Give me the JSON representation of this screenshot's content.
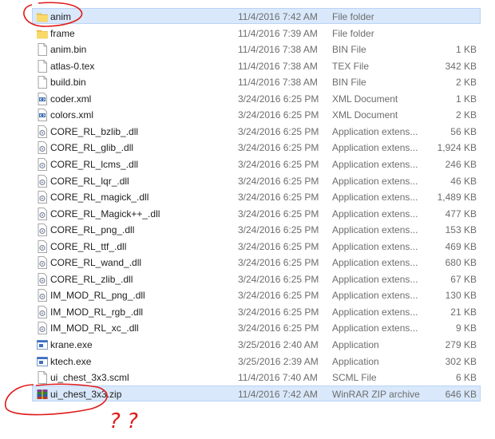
{
  "files": [
    {
      "name": "anim",
      "date": "11/4/2016 7:42 AM",
      "type": "File folder",
      "size": "",
      "icon": "folder-icon",
      "selected": true
    },
    {
      "name": "frame",
      "date": "11/4/2016 7:39 AM",
      "type": "File folder",
      "size": "",
      "icon": "folder-icon",
      "selected": false
    },
    {
      "name": "anim.bin",
      "date": "11/4/2016 7:38 AM",
      "type": "BIN File",
      "size": "1 KB",
      "icon": "file-icon",
      "selected": false
    },
    {
      "name": "atlas-0.tex",
      "date": "11/4/2016 7:38 AM",
      "type": "TEX File",
      "size": "342 KB",
      "icon": "file-icon",
      "selected": false
    },
    {
      "name": "build.bin",
      "date": "11/4/2016 7:38 AM",
      "type": "BIN File",
      "size": "2 KB",
      "icon": "file-icon",
      "selected": false
    },
    {
      "name": "coder.xml",
      "date": "3/24/2016 6:25 PM",
      "type": "XML Document",
      "size": "1 KB",
      "icon": "xml-file-icon",
      "selected": false
    },
    {
      "name": "colors.xml",
      "date": "3/24/2016 6:25 PM",
      "type": "XML Document",
      "size": "2 KB",
      "icon": "xml-file-icon",
      "selected": false
    },
    {
      "name": "CORE_RL_bzlib_.dll",
      "date": "3/24/2016 6:25 PM",
      "type": "Application extens...",
      "size": "56 KB",
      "icon": "dll-file-icon",
      "selected": false
    },
    {
      "name": "CORE_RL_glib_.dll",
      "date": "3/24/2016 6:25 PM",
      "type": "Application extens...",
      "size": "1,924 KB",
      "icon": "dll-file-icon",
      "selected": false
    },
    {
      "name": "CORE_RL_lcms_.dll",
      "date": "3/24/2016 6:25 PM",
      "type": "Application extens...",
      "size": "246 KB",
      "icon": "dll-file-icon",
      "selected": false
    },
    {
      "name": "CORE_RL_lqr_.dll",
      "date": "3/24/2016 6:25 PM",
      "type": "Application extens...",
      "size": "46 KB",
      "icon": "dll-file-icon",
      "selected": false
    },
    {
      "name": "CORE_RL_magick_.dll",
      "date": "3/24/2016 6:25 PM",
      "type": "Application extens...",
      "size": "1,489 KB",
      "icon": "dll-file-icon",
      "selected": false
    },
    {
      "name": "CORE_RL_Magick++_.dll",
      "date": "3/24/2016 6:25 PM",
      "type": "Application extens...",
      "size": "477 KB",
      "icon": "dll-file-icon",
      "selected": false
    },
    {
      "name": "CORE_RL_png_.dll",
      "date": "3/24/2016 6:25 PM",
      "type": "Application extens...",
      "size": "153 KB",
      "icon": "dll-file-icon",
      "selected": false
    },
    {
      "name": "CORE_RL_ttf_.dll",
      "date": "3/24/2016 6:25 PM",
      "type": "Application extens...",
      "size": "469 KB",
      "icon": "dll-file-icon",
      "selected": false
    },
    {
      "name": "CORE_RL_wand_.dll",
      "date": "3/24/2016 6:25 PM",
      "type": "Application extens...",
      "size": "680 KB",
      "icon": "dll-file-icon",
      "selected": false
    },
    {
      "name": "CORE_RL_zlib_.dll",
      "date": "3/24/2016 6:25 PM",
      "type": "Application extens...",
      "size": "67 KB",
      "icon": "dll-file-icon",
      "selected": false
    },
    {
      "name": "IM_MOD_RL_png_.dll",
      "date": "3/24/2016 6:25 PM",
      "type": "Application extens...",
      "size": "130 KB",
      "icon": "dll-file-icon",
      "selected": false
    },
    {
      "name": "IM_MOD_RL_rgb_.dll",
      "date": "3/24/2016 6:25 PM",
      "type": "Application extens...",
      "size": "21 KB",
      "icon": "dll-file-icon",
      "selected": false
    },
    {
      "name": "IM_MOD_RL_xc_.dll",
      "date": "3/24/2016 6:25 PM",
      "type": "Application extens...",
      "size": "9 KB",
      "icon": "dll-file-icon",
      "selected": false
    },
    {
      "name": "krane.exe",
      "date": "3/25/2016 2:40 AM",
      "type": "Application",
      "size": "279 KB",
      "icon": "exe-file-icon",
      "selected": false
    },
    {
      "name": "ktech.exe",
      "date": "3/25/2016 2:39 AM",
      "type": "Application",
      "size": "302 KB",
      "icon": "exe-file-icon",
      "selected": false
    },
    {
      "name": "ui_chest_3x3.scml",
      "date": "11/4/2016 7:40 AM",
      "type": "SCML File",
      "size": "6 KB",
      "icon": "file-icon",
      "selected": false
    },
    {
      "name": "ui_chest_3x3.zip",
      "date": "11/4/2016 7:42 AM",
      "type": "WinRAR ZIP archive",
      "size": "646 KB",
      "icon": "zip-archive-icon",
      "selected": true
    }
  ],
  "annotations": {
    "scribble": "? ?",
    "color": "#e01a1a"
  },
  "colors": {
    "selection_bg": "#d9e8fb",
    "selection_border": "#b9d3f7",
    "folder": "#f2c94c",
    "meta_text": "#6d6d6d"
  }
}
